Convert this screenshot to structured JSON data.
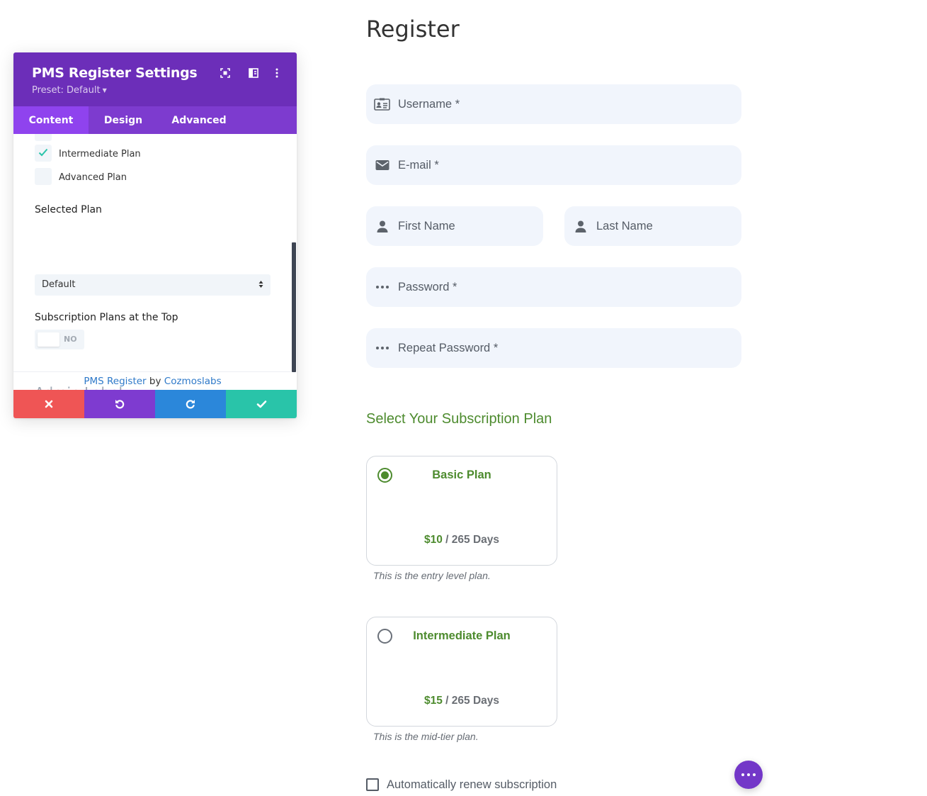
{
  "colors": {
    "panel_header": "#6c2eb9",
    "tab_bar": "#7d3bcf",
    "tab_active": "#8f43ee",
    "action_cancel": "#ef5555",
    "action_undo": "#7e3bd0",
    "action_redo": "#2b87da",
    "action_save": "#29c4a9",
    "plan_green": "#4d8b2e",
    "input_bg": "#f1f5fc",
    "fab": "#7337c8"
  },
  "panel": {
    "title": "PMS Register Settings",
    "preset": "Preset: Default",
    "icons": [
      "expand-icon",
      "columns-icon",
      "more-vertical-icon"
    ],
    "tabs": [
      {
        "label": "Content",
        "active": true
      },
      {
        "label": "Design",
        "active": false
      },
      {
        "label": "Advanced",
        "active": false
      }
    ],
    "plans": [
      {
        "label": "Intermediate Plan",
        "checked": true
      },
      {
        "label": "Advanced Plan",
        "checked": false
      }
    ],
    "selected_plan_label": "Selected Plan",
    "selected_plan_value": "Default",
    "top_plans_label": "Subscription Plans at the Top",
    "toggle_value": "NO",
    "admin_label": "Admin Label",
    "credit": {
      "plugin": "PMS Register",
      "by": "by",
      "author": "Cozmoslabs"
    },
    "actions": [
      "close-icon",
      "undo-icon",
      "redo-icon",
      "check-icon"
    ]
  },
  "form": {
    "title": "Register",
    "fields": {
      "username": "Username *",
      "email": "E-mail *",
      "first_name": "First Name",
      "last_name": "Last Name",
      "password": "Password *",
      "repeat_password": "Repeat Password *"
    },
    "plans_title": "Select Your Subscription Plan",
    "plans": [
      {
        "name": "Basic Plan",
        "price": "$10",
        "period": "/ 265 Days",
        "description": "This is the entry level plan.",
        "selected": true
      },
      {
        "name": "Intermediate Plan",
        "price": "$15",
        "period": "/ 265 Days",
        "description": "This is the mid-tier plan.",
        "selected": false
      }
    ],
    "auto_renew_label": "Automatically renew subscription",
    "auto_renew_checked": false
  }
}
